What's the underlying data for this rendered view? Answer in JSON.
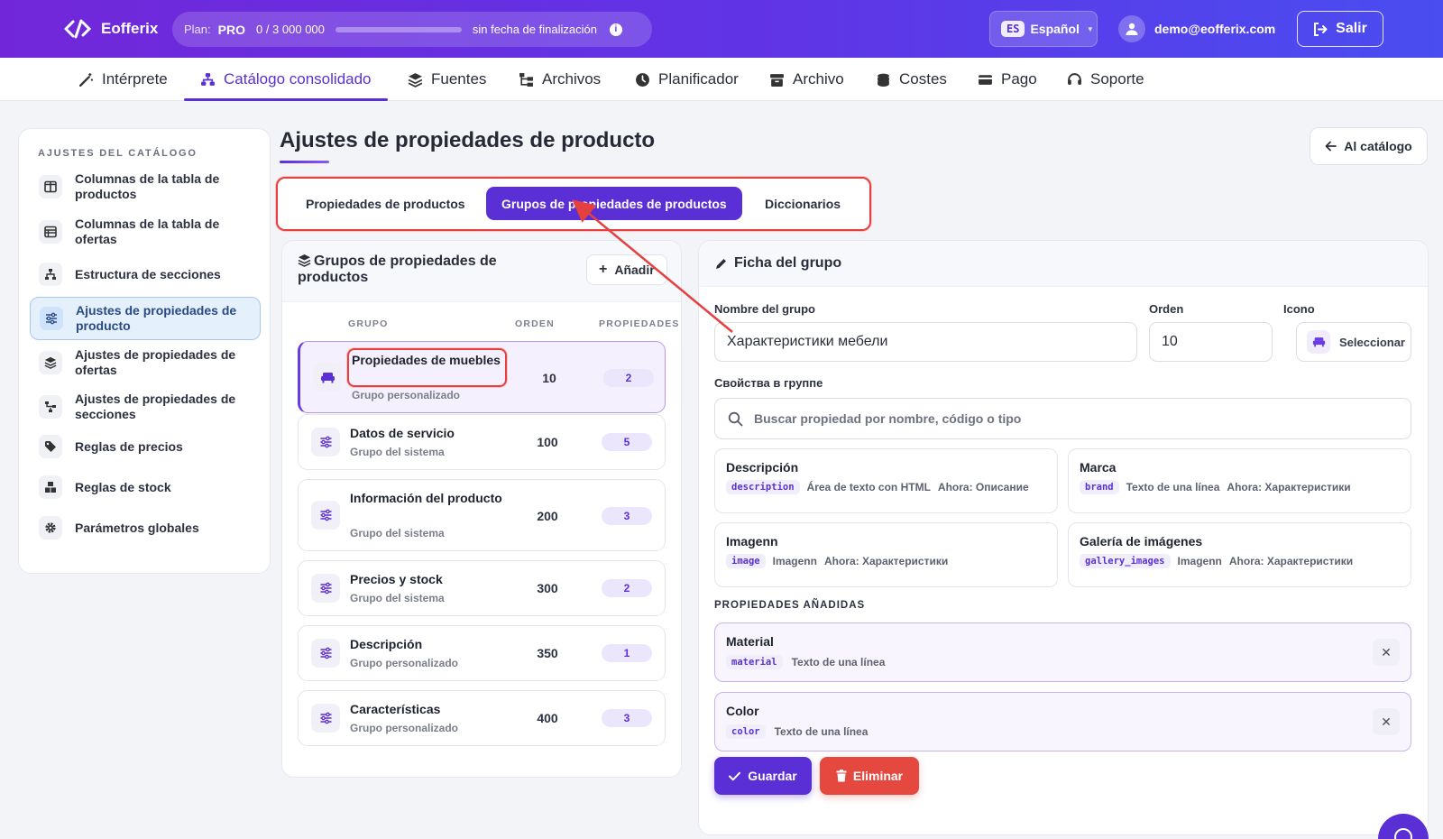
{
  "app": {
    "name": "Eofferix"
  },
  "plan": {
    "label": "Plan:",
    "tier": "PRO",
    "usage": "0 / 3 000 000",
    "usage_fraction": 0.0,
    "expiry": "sin fecha de finalización"
  },
  "lang": {
    "code": "ES",
    "label": "Español"
  },
  "user": {
    "email": "demo@eofferix.com"
  },
  "logout": {
    "label": "Salir"
  },
  "nav": {
    "items": [
      {
        "label": "Intérprete",
        "icon": "magic-wand-icon"
      },
      {
        "label": "Catálogo consolidado",
        "icon": "sitemap-icon"
      },
      {
        "label": "Fuentes",
        "icon": "layers-icon"
      },
      {
        "label": "Archivos",
        "icon": "folder-tree-icon"
      },
      {
        "label": "Planificador",
        "icon": "clock-icon"
      },
      {
        "label": "Archivo",
        "icon": "archive-icon"
      },
      {
        "label": "Costes",
        "icon": "coins-icon"
      },
      {
        "label": "Pago",
        "icon": "credit-card-icon"
      },
      {
        "label": "Soporte",
        "icon": "headset-icon"
      }
    ],
    "active": "Catálogo consolidado"
  },
  "sidebar": {
    "title": "AJUSTES DEL CATÁLOGO",
    "items": [
      {
        "label": "Columnas de la tabla de productos",
        "icon": "table-columns-icon"
      },
      {
        "label": "Columnas de la tabla de ofertas",
        "icon": "table-list-icon"
      },
      {
        "label": "Estructura de secciones",
        "icon": "hierarchy-icon"
      },
      {
        "label": "Ajustes de propiedades de producto",
        "icon": "sliders-icon"
      },
      {
        "label": "Ajustes de propiedades de ofertas",
        "icon": "layers-icon"
      },
      {
        "label": "Ajustes de propiedades de secciones",
        "icon": "diagram-icon"
      },
      {
        "label": "Reglas de precios",
        "icon": "tags-icon"
      },
      {
        "label": "Reglas de stock",
        "icon": "boxes-icon"
      },
      {
        "label": "Parámetros globales",
        "icon": "gear-icon"
      }
    ]
  },
  "page": {
    "title": "Ajustes de propiedades de producto",
    "back_label": "Al catálogo"
  },
  "tabs": {
    "items": [
      "Propiedades de productos",
      "Grupos de propiedades de productos",
      "Diccionarios"
    ],
    "active": "Grupos de propiedades de productos"
  },
  "groups": {
    "title": "Grupos de propiedades de productos",
    "add_label": "Añadir",
    "columns": {
      "group": "GRUPO",
      "order": "ORDEN",
      "props": "PROPIEDADES"
    },
    "rows": [
      {
        "name": "Propiedades de muebles",
        "type": "Grupo personalizado",
        "order": "10",
        "count": "2",
        "icon": "sofa-icon"
      },
      {
        "name": "Datos de servicio",
        "type": "Grupo del sistema",
        "order": "100",
        "count": "5",
        "icon": "sliders-icon"
      },
      {
        "name": "Información del producto",
        "type": "Grupo del sistema",
        "order": "200",
        "count": "3",
        "icon": "sliders-icon"
      },
      {
        "name": "Precios y stock",
        "type": "Grupo del sistema",
        "order": "300",
        "count": "2",
        "icon": "sliders-icon"
      },
      {
        "name": "Descripción",
        "type": "Grupo personalizado",
        "order": "350",
        "count": "1",
        "icon": "sliders-icon"
      },
      {
        "name": "Características",
        "type": "Grupo personalizado",
        "order": "400",
        "count": "3",
        "icon": "sliders-icon"
      }
    ]
  },
  "form": {
    "title": "Ficha del grupo",
    "name_label": "Nombre del grupo",
    "name_value": "Характеристики мебели",
    "order_label": "Orden",
    "order_value": "10",
    "icon_label": "Icono",
    "icon_button": "Seleccionar",
    "props_label": "Свойства в группе",
    "search_placeholder": "Buscar propiedad por nombre, código o tipo",
    "available": [
      {
        "name": "Descripción",
        "code": "description",
        "type": "Área de texto con HTML",
        "now": "Ahora: Описание"
      },
      {
        "name": "Marca",
        "code": "brand",
        "type": "Texto de una línea",
        "now": "Ahora: Характеристики"
      },
      {
        "name": "Imagenn",
        "code": "image",
        "type": "Imagenn",
        "now": "Ahora: Характеристики"
      },
      {
        "name": "Galería de imágenes",
        "code": "gallery_images",
        "type": "Imagenn",
        "now": "Ahora: Характеристики"
      }
    ],
    "added_label": "PROPIEDADES AÑADIDAS",
    "added": [
      {
        "name": "Material",
        "code": "material",
        "type": "Texto de una línea"
      },
      {
        "name": "Color",
        "code": "color",
        "type": "Texto de una línea"
      }
    ],
    "save_label": "Guardar",
    "delete_label": "Eliminar"
  },
  "colors": {
    "accent": "#5b2fd6",
    "danger": "#e5483f",
    "highlight": "#e5403f"
  }
}
